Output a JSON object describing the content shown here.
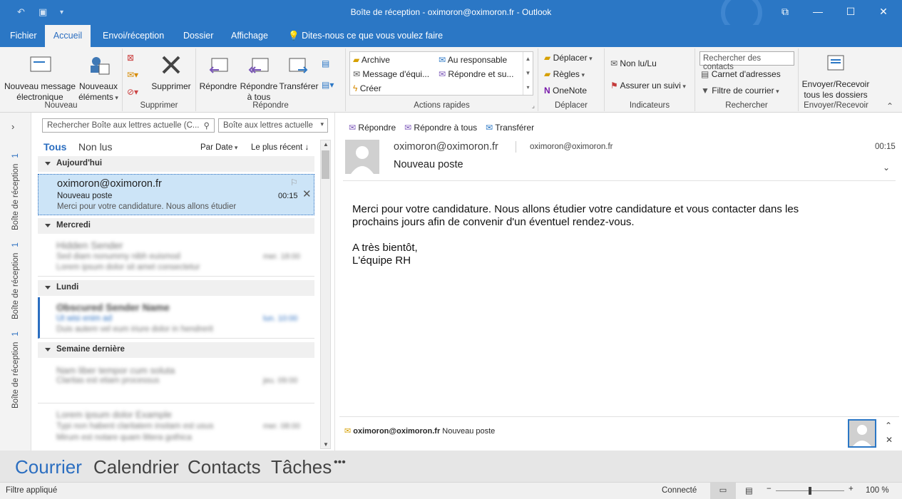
{
  "window": {
    "title": "Boîte de réception - oximoron@oximoron.fr - Outlook"
  },
  "tabs": [
    "Fichier",
    "Accueil",
    "Envoi/réception",
    "Dossier",
    "Affichage"
  ],
  "tell_me": "Dites-nous ce que vous voulez faire",
  "ribbon": {
    "nouveau": {
      "label": "Nouveau",
      "new_message": "Nouveau message électronique",
      "new_items": "Nouveaux éléments"
    },
    "supprimer": {
      "label": "Supprimer",
      "delete": "Supprimer"
    },
    "repondre": {
      "label": "Répondre",
      "reply": "Répondre",
      "reply_all": "Répondre à tous",
      "forward": "Transférer"
    },
    "actions": {
      "label": "Actions rapides",
      "items": [
        "Archive",
        "Au responsable",
        "Message d'équi...",
        "Répondre et su...",
        "Créer"
      ]
    },
    "deplacer": {
      "label": "Déplacer",
      "move": "Déplacer",
      "rules": "Règles",
      "onenote": "OneNote"
    },
    "indicateurs": {
      "label": "Indicateurs",
      "unread": "Non lu/Lu",
      "followup": "Assurer un suivi"
    },
    "rechercher": {
      "label": "Rechercher",
      "search_people": "Rechercher des contacts",
      "address_book": "Carnet d'adresses",
      "filter": "Filtre de courrier"
    },
    "envoyer": {
      "label": "Envoyer/Recevoir",
      "send_all": "Envoyer/Recevoir tous les dossiers"
    }
  },
  "left_rail": {
    "folders": [
      {
        "name": "Boîte de réception",
        "count": "1"
      },
      {
        "name": "Boîte de réception",
        "count": "1"
      },
      {
        "name": "Boîte de réception",
        "count": "1"
      }
    ]
  },
  "list": {
    "search_placeholder": "Rechercher Boîte aux lettres actuelle (C...",
    "scope": "Boîte aux lettres actuelle",
    "filter_all": "Tous",
    "filter_unread": "Non lus",
    "sort_by": "Par Date",
    "sort_order": "Le plus récent",
    "groups": {
      "today": "Aujourd'hui",
      "wednesday": "Mercredi",
      "monday": "Lundi",
      "last_week": "Semaine dernière"
    },
    "selected": {
      "sender": "oximoron@oximoron.fr",
      "subject": "Nouveau poste",
      "time": "00:15",
      "preview": "Merci pour votre candidature. Nous allons étudier"
    },
    "blurred": [
      {
        "sender": "Hidden Sender",
        "subject": "Sed diam nonummy nibh euismod",
        "time": "mer. 18:00",
        "preview": "Lorem ipsum dolor sit amet consectetur"
      },
      {
        "sender": "Obscured Sender Name",
        "subject": "Ut wisi enim ad",
        "time": "lun. 10:00",
        "preview": "Duis autem vel eum iriure dolor in hendrerit"
      },
      {
        "sender": "Nam liber tempor cum soluta",
        "subject": "Claritas est etiam processus",
        "time": "jeu. 09:00",
        "preview": ""
      },
      {
        "sender": "Lorem ipsum dolor Example",
        "subject": "Typi non habent claritatem insitam est usus",
        "time": "mer. 08:00",
        "preview": "Mirum est notare quam littera gothica"
      }
    ]
  },
  "reading": {
    "actions": {
      "reply": "Répondre",
      "reply_all": "Répondre à tous",
      "forward": "Transférer"
    },
    "from": "oximoron@oximoron.fr",
    "to": "oximoron@oximoron.fr",
    "time": "00:15",
    "subject": "Nouveau poste",
    "body_line1": "Merci pour votre candidature. Nous allons étudier votre candidature et vous contacter dans les",
    "body_line2": "prochains jours afin de convenir d'un éventuel rendez-vous.",
    "body_line3": "A très bientôt,",
    "body_line4": "L'équipe RH",
    "people_sender": "oximoron@oximoron.fr",
    "people_subject": "Nouveau poste"
  },
  "nav": {
    "mail": "Courrier",
    "calendar": "Calendrier",
    "contacts": "Contacts",
    "tasks": "Tâches",
    "more": "•••"
  },
  "status": {
    "left": "Filtre appliqué",
    "connection": "Connecté",
    "zoom": "100 %"
  },
  "colors": {
    "accent": "#2b77c5",
    "selected": "#cce4f7",
    "nav_active": "#2b6ec0"
  }
}
